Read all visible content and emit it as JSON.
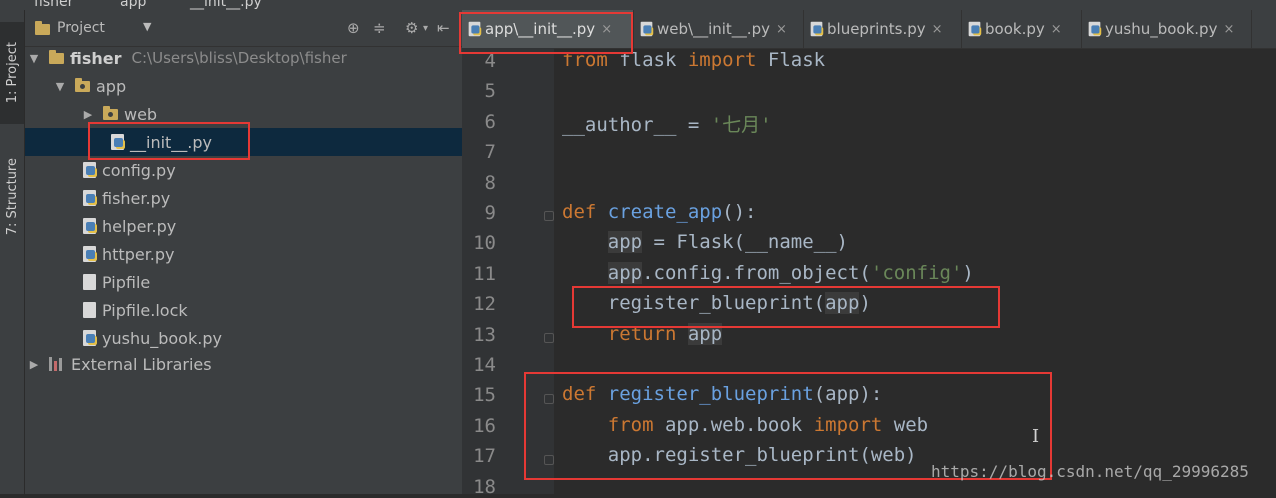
{
  "breadcrumb": [
    "fisher",
    "app",
    "__init__.py"
  ],
  "side_tabs": {
    "project": "1: Project",
    "structure": "7: Structure"
  },
  "project_panel": {
    "title": "Project",
    "tree": [
      {
        "label": "fisher",
        "path": "C:\\Users\\bliss\\Desktop\\fisher",
        "type": "folder",
        "expanded": true
      },
      {
        "label": "app",
        "type": "package",
        "expanded": true
      },
      {
        "label": "web",
        "type": "package",
        "expanded": false
      },
      {
        "label": "__init__.py",
        "type": "python-file",
        "selected": true
      },
      {
        "label": "config.py",
        "type": "python-file"
      },
      {
        "label": "fisher.py",
        "type": "python-file"
      },
      {
        "label": "helper.py",
        "type": "python-file"
      },
      {
        "label": "httper.py",
        "type": "python-file"
      },
      {
        "label": "Pipfile",
        "type": "file"
      },
      {
        "label": "Pipfile.lock",
        "type": "file"
      },
      {
        "label": "yushu_book.py",
        "type": "python-file"
      },
      {
        "label": "External Libraries",
        "type": "library",
        "expanded": false
      }
    ]
  },
  "editor": {
    "tabs": [
      {
        "label": "app\\__init__.py",
        "active": true
      },
      {
        "label": "web\\__init__.py"
      },
      {
        "label": "blueprints.py"
      },
      {
        "label": "book.py"
      },
      {
        "label": "yushu_book.py"
      }
    ],
    "line_numbers": [
      "4",
      "5",
      "6",
      "7",
      "8",
      "9",
      "10",
      "11",
      "12",
      "13",
      "14",
      "15",
      "16",
      "17",
      "18"
    ],
    "code": {
      "l4_kw1": "from",
      "l4_mod": " flask ",
      "l4_kw2": "import",
      "l4_name": " Flask",
      "l6_name": "__author__",
      "l6_eq": " = ",
      "l6_str": "'七月'",
      "l9_kw": "def",
      "l9_fn": "create_app",
      "l9_rest": "():",
      "l10_a": "app",
      "l10_b": " = Flask(__name__)",
      "l11_a": "app",
      "l11_b": ".config.from_object(",
      "l11_str": "'config'",
      "l11_c": ")",
      "l12_a": "register_blueprint(",
      "l12_b": "app",
      "l12_c": ")",
      "l13_kw": "return",
      "l13_b": "app",
      "l15_kw": "def",
      "l15_fn": "register_blueprint",
      "l15_rest": "(app):",
      "l16_kw1": "from",
      "l16_mod": " app.web.book ",
      "l16_kw2": "import",
      "l16_name": " web",
      "l17_a": "app.register_blueprint(web)"
    }
  },
  "watermark": "https://blog.csdn.net/qq_29996285",
  "colors": {
    "annotation_red": "#e53935",
    "keyword": "#cc7832",
    "function": "#6aa1e0",
    "string": "#6a8759"
  }
}
